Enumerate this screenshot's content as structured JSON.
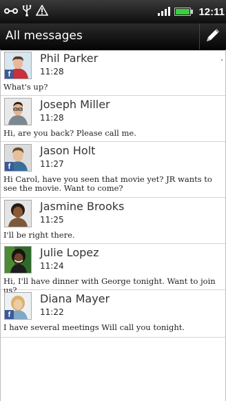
{
  "status_bar": {
    "time": "12:11"
  },
  "header": {
    "title": "All messages",
    "compose_icon": "pencil-icon"
  },
  "messages": [
    {
      "name": "Phil Parker",
      "time": "11:28",
      "preview": "What's up?",
      "facebook": true
    },
    {
      "name": "Joseph Miller",
      "time": "11:28",
      "preview": "Hi, are you back? Please call me.",
      "facebook": false
    },
    {
      "name": "Jason Holt",
      "time": "11:27",
      "preview": "Hi Carol, have you seen that movie yet? JR wants to see the movie. Want to come?",
      "facebook": true
    },
    {
      "name": "Jasmine Brooks",
      "time": "11:25",
      "preview": "I'll be right there.",
      "facebook": false
    },
    {
      "name": "Julie Lopez",
      "time": "11:24",
      "preview": "Hi, I'll have dinner with George tonight. Want to join us?",
      "facebook": false
    },
    {
      "name": "Diana Mayer",
      "time": "11:22",
      "preview": "I have several meetings  Will call you tonight.",
      "facebook": true
    }
  ],
  "colors": {
    "facebook_badge": "#3b5998",
    "battery": "#37d23a"
  }
}
